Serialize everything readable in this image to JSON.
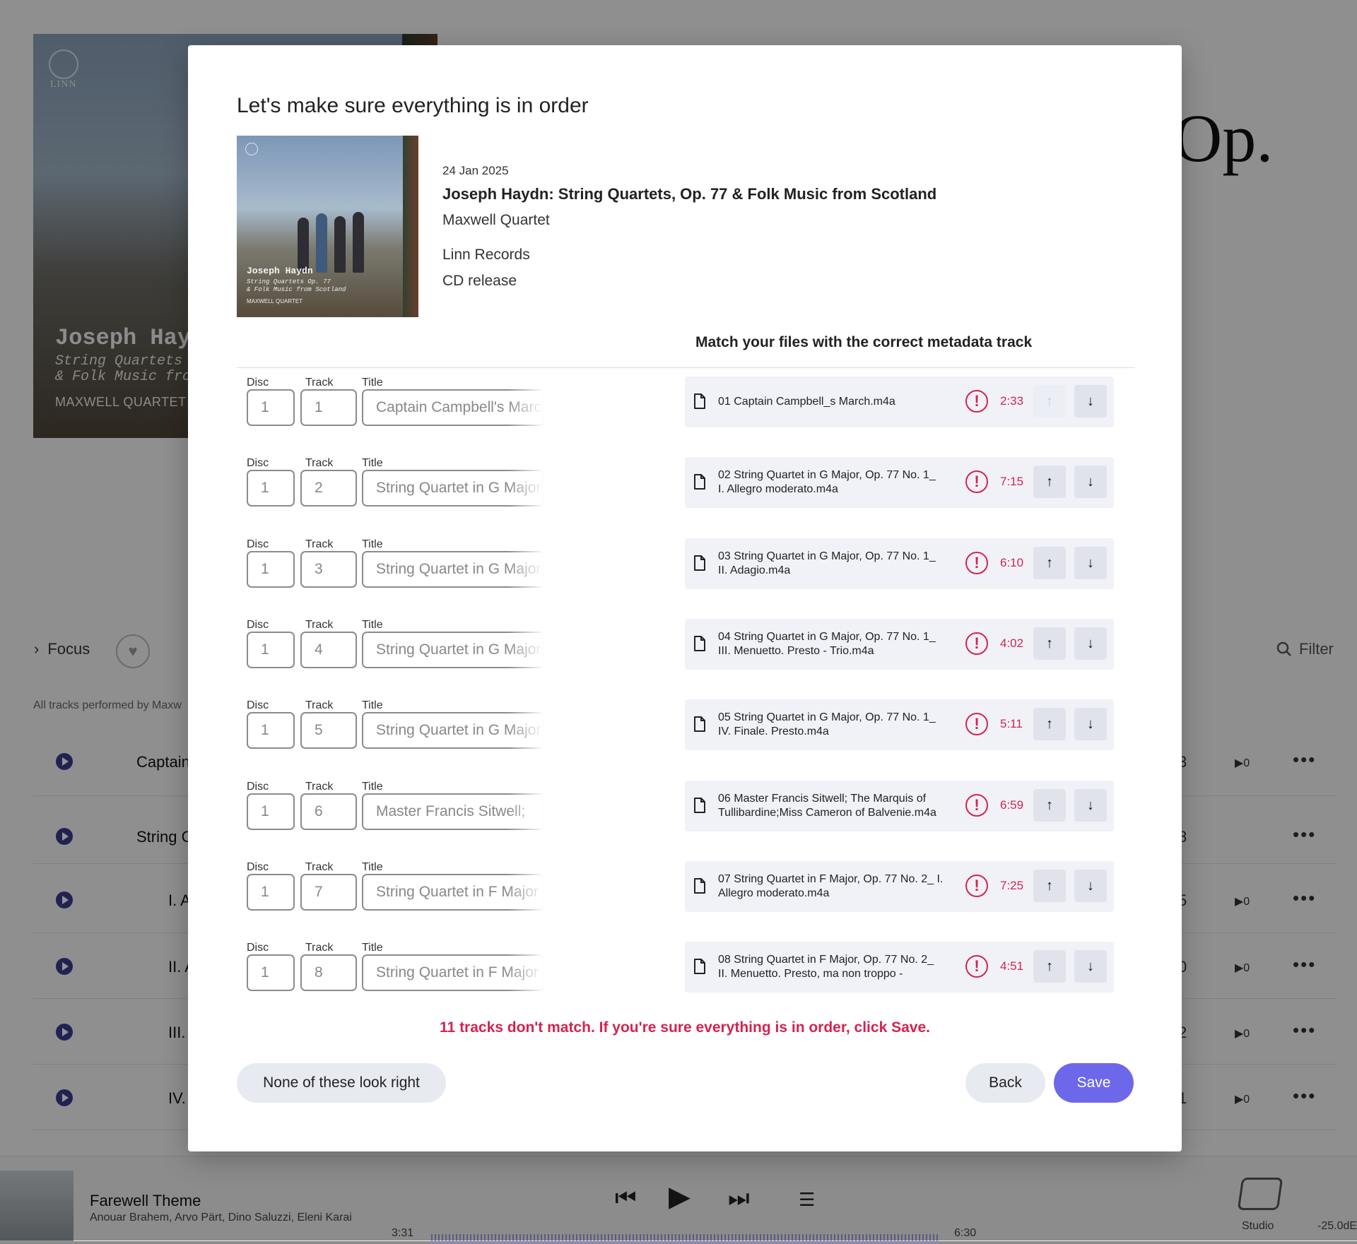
{
  "background": {
    "cover": {
      "logo": "LINN",
      "title": "Joseph Hay",
      "subtitle_1": "String Quartets Op",
      "subtitle_2": "& Folk Music from",
      "artist": "MAXWELL QUARTET"
    },
    "big_title": "Op.",
    "focus_label": "Focus",
    "filter_label": "Filter",
    "performed_by": "All tracks performed by Maxw",
    "rows": [
      {
        "name": "Captain",
        "num": "3",
        "count": "▶0"
      },
      {
        "name": "String C",
        "num": "8",
        "count": ""
      },
      {
        "name": "I. A",
        "num": "5",
        "count": "▶0"
      },
      {
        "name": "II. A",
        "num": "0",
        "count": "▶0"
      },
      {
        "name": "III.",
        "num": "2",
        "count": "▶0"
      },
      {
        "name": "IV.",
        "num": "1",
        "count": "▶0"
      }
    ],
    "player": {
      "song": "Farewell Theme",
      "artists": "Anouar Brahem, Arvo Pärt, Dino Saluzzi, Eleni Karai",
      "elapsed": "3:31",
      "total": "6:30",
      "output": "Studio",
      "volume": "-25.0dE"
    }
  },
  "modal": {
    "title": "Let's make sure everything is in order",
    "release_date": "24 Jan 2025",
    "album": "Joseph Haydn: String Quartets, Op. 77 & Folk Music from Scotland",
    "artist": "Maxwell Quartet",
    "label": "Linn Records",
    "format": "CD release",
    "cover_text": {
      "title": "Joseph Haydn",
      "sub1": "String Quartets Op. 77",
      "sub2": "& Folk Music from Scotland",
      "artist": "MAXWELL QUARTET"
    },
    "match_heading": "Match your files with the correct metadata track",
    "labels": {
      "disc": "Disc",
      "track": "Track",
      "title": "Title"
    },
    "tracks": [
      {
        "disc": "1",
        "track": "1",
        "title": "Captain Campbell's March",
        "file_line1": "01 Captain Campbell_s March.m4a",
        "file_line2": "",
        "duration": "2:33"
      },
      {
        "disc": "1",
        "track": "2",
        "title": "String Quartet in G Major",
        "file_line1": "02 String Quartet in G Major, Op. 77 No. 1_",
        "file_line2": "I. Allegro moderato.m4a",
        "duration": "7:15"
      },
      {
        "disc": "1",
        "track": "3",
        "title": "String Quartet in G Major",
        "file_line1": "03 String Quartet in G Major, Op. 77 No. 1_",
        "file_line2": "II. Adagio.m4a",
        "duration": "6:10"
      },
      {
        "disc": "1",
        "track": "4",
        "title": "String Quartet in G Major",
        "file_line1": "04 String Quartet in G Major, Op. 77 No. 1_",
        "file_line2": "III. Menuetto. Presto - Trio.m4a",
        "duration": "4:02"
      },
      {
        "disc": "1",
        "track": "5",
        "title": "String Quartet in G Major",
        "file_line1": "05 String Quartet in G Major, Op. 77 No. 1_",
        "file_line2": "IV. Finale. Presto.m4a",
        "duration": "5:11"
      },
      {
        "disc": "1",
        "track": "6",
        "title": "Master Francis Sitwell;",
        "file_line1": "06 Master Francis Sitwell; The Marquis of",
        "file_line2": "Tullibardine;Miss Cameron of Balvenie.m4a",
        "duration": "6:59"
      },
      {
        "disc": "1",
        "track": "7",
        "title": "String Quartet in F Major",
        "file_line1": "07 String Quartet in F Major, Op. 77 No. 2_ I.",
        "file_line2": "Allegro moderato.m4a",
        "duration": "7:25"
      },
      {
        "disc": "1",
        "track": "8",
        "title": "String Quartet in F Major",
        "file_line1": "08 String Quartet in F Major, Op. 77 No. 2_",
        "file_line2": "II. Menuetto. Presto, ma non troppo -",
        "duration": "4:51"
      }
    ],
    "error_message": "11 tracks don't match. If you're sure everything is in order, click Save.",
    "buttons": {
      "none": "None of these look right",
      "back": "Back",
      "save": "Save"
    },
    "colors": {
      "error": "#d3244f",
      "primary": "#6d68ea"
    }
  }
}
